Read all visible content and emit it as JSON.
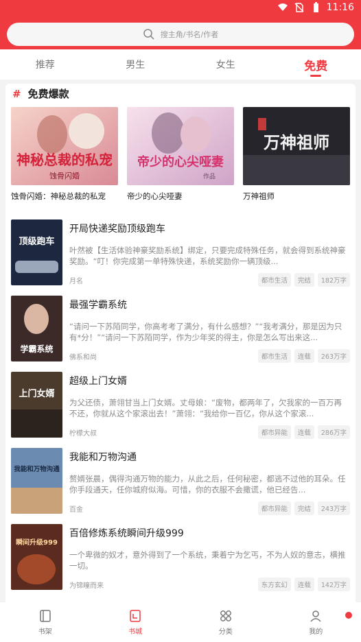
{
  "status": {
    "time": "11:16"
  },
  "search": {
    "placeholder": "搜主角/书名/作者"
  },
  "tabs": [
    {
      "label": "推荐"
    },
    {
      "label": "男生"
    },
    {
      "label": "女生"
    },
    {
      "label": "免费"
    }
  ],
  "section": {
    "hash": "#",
    "title": "免费爆款"
  },
  "featured": [
    {
      "title": "蚀骨闪婚：神秘总裁的私宠",
      "cover_text": "神秘总裁的私宠",
      "cover_sub": "蚀骨闪婚",
      "cover_color": "#e8a7b2"
    },
    {
      "title": "帝少的心尖哑妻",
      "cover_text": "帝少的心尖哑妻",
      "cover_sub": "作品",
      "cover_color": "#e6b8d1"
    },
    {
      "title": "万神祖师",
      "cover_text": "万神祖师",
      "cover_sub": "",
      "cover_color": "#2a2a30"
    }
  ],
  "books": [
    {
      "name": "开局快递奖励顶级跑车",
      "desc": "叶然被【生活体验神豪奖励系统】绑定，只要完成特殊任务，就会得到系统神豪奖励。“叮！你完成第一单特殊快递，系统奖励你一辆顶级...",
      "author": "月名",
      "tags": [
        "都市生活",
        "完结",
        "182万字"
      ],
      "cover_text": "顶级跑车",
      "cover_color": "#1d2740"
    },
    {
      "name": "最强学霸系统",
      "desc": "“请问一下苏陌同学，你高考考了满分，有什么感想？”“我考满分，那是因为只有*分！”“请问一下苏陌同学，作为少年奖的得主，你是怎么写出来这...",
      "author": "佛系和尚",
      "tags": [
        "都市生活",
        "连载",
        "263万字"
      ],
      "cover_text": "学霸系统",
      "cover_color": "#3b2a28"
    },
    {
      "name": "超级上门女婿",
      "desc": "为父还债，萧翎甘当上门女婿。丈母娘：“废物，都两年了，欠我家的一百万再不还，你就从这个家滚出去！”萧翎：“我给你一百亿，你从这个家滚...",
      "author": "柠檬大叔",
      "tags": [
        "都市异能",
        "连载",
        "286万字"
      ],
      "cover_text": "上门女婿",
      "cover_color": "#4a3b2c"
    },
    {
      "name": "我能和万物沟通",
      "desc": "赘婿张晨，偶得沟通万物的能力，从此之后，任何秘密，都逃不过他的耳朵。任你手段通天，任你城府似海。可惜，你的衣服不会撒谎，他已经告...",
      "author": "百金",
      "tags": [
        "都市异能",
        "完结",
        "243万字"
      ],
      "cover_text": "我能和万物沟通",
      "cover_color": "#6b8bb0"
    },
    {
      "name": "百倍修炼系统瞬间升级999",
      "desc": "一个卑微的奴才，意外得到了一个系统，秉着宁为乞丐，不为人奴的意志，横推一切。",
      "author": "为锦瞳而来",
      "tags": [
        "东方玄幻",
        "连载",
        "142万字"
      ],
      "cover_text": "瞬间升级999",
      "cover_color": "#5a2b1e"
    }
  ],
  "bottom_nav": [
    {
      "label": "书架"
    },
    {
      "label": "书城"
    },
    {
      "label": "分类"
    },
    {
      "label": "我的"
    }
  ],
  "colors": {
    "accent": "#ef3a3f"
  }
}
